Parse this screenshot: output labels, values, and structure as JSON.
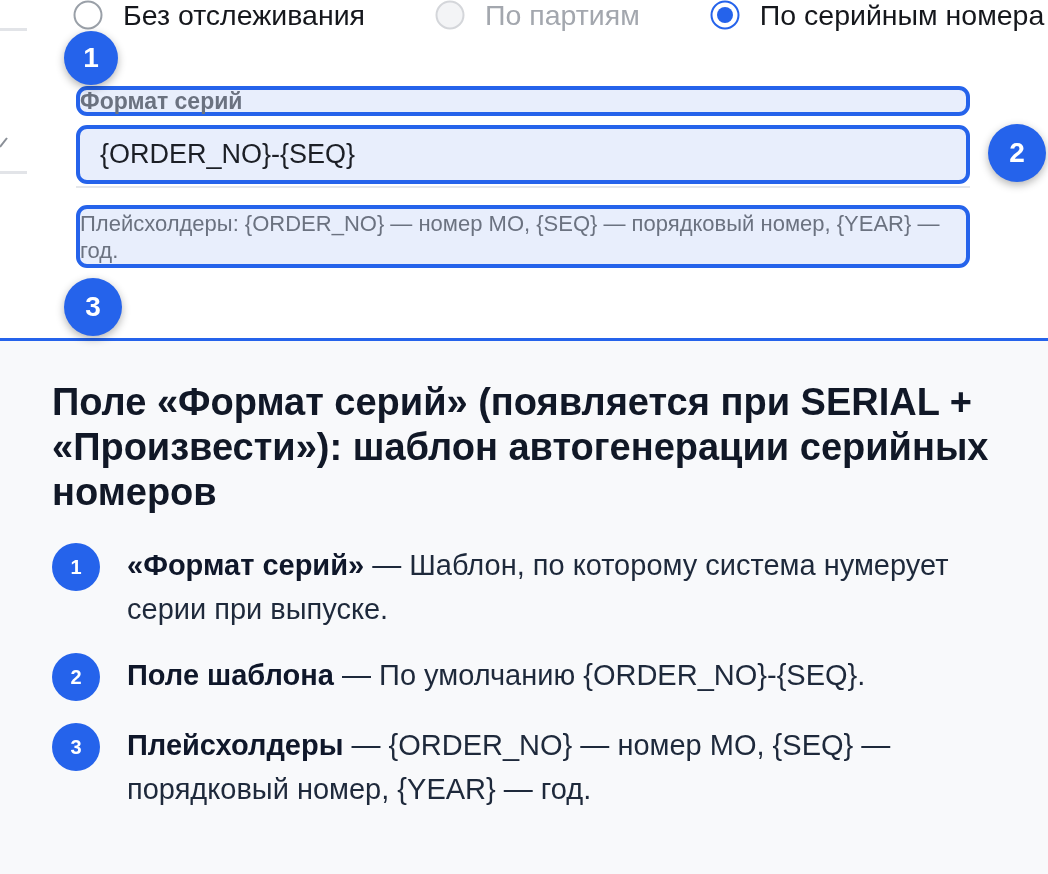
{
  "tracking_options": [
    {
      "label": "Без отслеживания",
      "selected": false,
      "disabled": false
    },
    {
      "label": "По партиям",
      "selected": false,
      "disabled": true
    },
    {
      "label": "По серийным номера",
      "selected": true,
      "disabled": false
    }
  ],
  "serial_format": {
    "label": "Формат серий",
    "value": "{ORDER_NO}-{SEQ}",
    "hint": "Плейсхолдеры: {ORDER_NO} — номер МО, {SEQ} — порядковый номер, {YEAR} — год."
  },
  "callouts": [
    {
      "number": "1"
    },
    {
      "number": "2"
    },
    {
      "number": "3"
    }
  ],
  "explanation": {
    "title": "Поле «Формат серий» (появляется при SERIAL + «Произвести»): шаблон автогенерации серийных номеров",
    "items": [
      {
        "number": "1",
        "text": "**«Формат серий»** — Шаблон, по которому система нумерует серии при выпуске."
      },
      {
        "number": "2",
        "text": "**Поле шаблона** — По умолчанию {ORDER_NO}-{SEQ}."
      },
      {
        "number": "3",
        "text": "**Плейсхолдеры** — {ORDER_NO} — номер МО, {SEQ} — порядковый номер, {YEAR} — год."
      }
    ]
  }
}
